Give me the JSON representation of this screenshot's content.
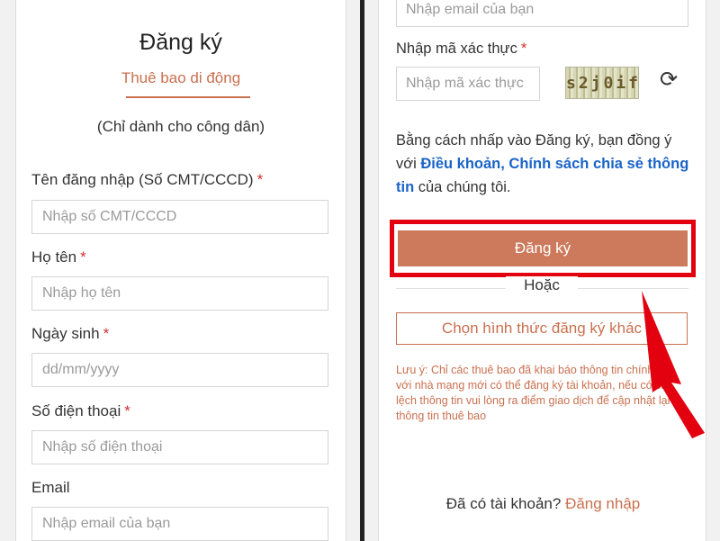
{
  "left": {
    "title": "Đăng ký",
    "tab_label": "Thuê bao di động",
    "note": "(Chỉ dành cho công dân)",
    "required_mark": "*",
    "fields": {
      "username": {
        "label": "Tên đăng nhập (Số CMT/CCCD)",
        "placeholder": "Nhập số CMT/CCCD",
        "required": true
      },
      "fullname": {
        "label": "Họ tên",
        "placeholder": "Nhập họ tên",
        "required": true
      },
      "dob": {
        "label": "Ngày sinh",
        "placeholder": "dd/mm/yyyy",
        "required": true
      },
      "phone": {
        "label": "Số điện thoại",
        "placeholder": "Nhập số điện thoại",
        "required": true
      },
      "email": {
        "label": "Email",
        "placeholder": "Nhập email của bạn",
        "required": false
      }
    }
  },
  "right": {
    "email_placeholder": "Nhập email của bạn",
    "captcha_label": "Nhập mã xác thực",
    "captcha_placeholder": "Nhập mã xác thực",
    "captcha_text": "s2j0if",
    "refresh_icon": "refresh-icon",
    "terms_prefix": "Bằng cách nhấp vào Đăng ký, bạn đồng ý với ",
    "terms_link": "Điều khoản, Chính sách chia sẻ thông tin",
    "terms_suffix": " của chúng tôi.",
    "register_button": "Đăng ký",
    "or_text": "Hoặc",
    "alt_button": "Chọn hình thức đăng ký khác",
    "footnote": "Lưu ý: Chỉ các thuê bao đã khai báo thông tin chính xác với nhà mạng mới có thể đăng ký tài khoản, nếu có sai lệch thông tin vui lòng ra điểm giao dịch để cập nhật lại thông tin thuê bao",
    "login_prompt": "Đã có tài khoản?",
    "login_link": "Đăng nhập"
  },
  "colors": {
    "accent": "#c9704f",
    "button": "#cc7a5b",
    "link": "#1a64c7",
    "highlight": "#e3000f",
    "required": "#d32f2f"
  }
}
